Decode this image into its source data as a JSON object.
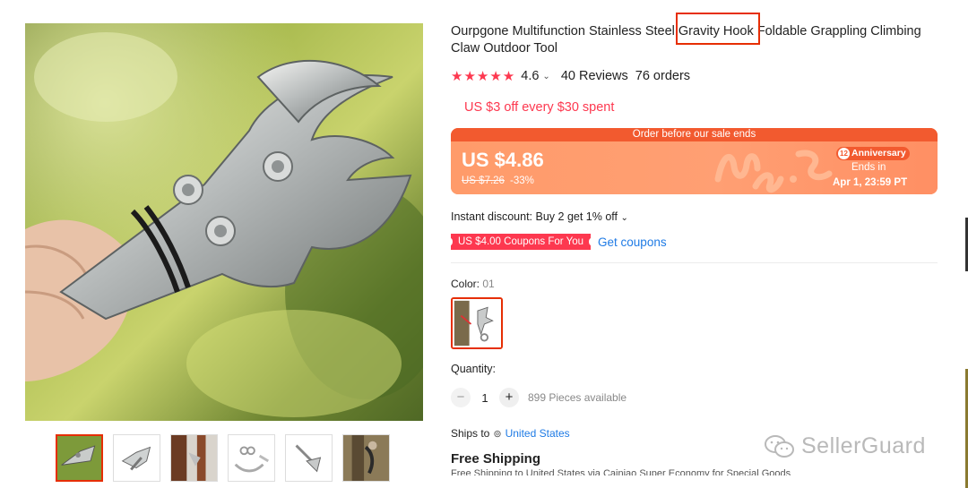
{
  "product": {
    "title": "Ourpgone Multifunction Stainless Steel Gravity Hook Foldable Grappling Climbing Claw Outdoor Tool",
    "highlighted_text": "Gravity Hook",
    "rating": "4.6",
    "stars": 5,
    "reviews": "40 Reviews",
    "orders": "76 orders"
  },
  "promo": {
    "text": "US $3 off every $30 spent"
  },
  "sale": {
    "header": "Order before our sale ends",
    "price": "US $4.86",
    "original_price": "US $7.26",
    "discount": "-33%",
    "badge_number": "12",
    "badge_label": "Anniversary",
    "ends_label": "Ends in",
    "ends_date": "Apr 1, 23:59 PT"
  },
  "discounts": {
    "instant": "Instant discount: Buy 2 get 1% off",
    "coupon_tag": "US $4.00 Coupons For You",
    "get_coupons": "Get coupons"
  },
  "options": {
    "color_label": "Color:",
    "color_value": "01"
  },
  "quantity": {
    "label": "Quantity:",
    "minus": "−",
    "value": "1",
    "plus": "+",
    "available": "899 Pieces available"
  },
  "shipping": {
    "ships_to_label": "Ships to",
    "country": "United States",
    "free_shipping": "Free Shipping",
    "detail": "Free Shipping to United States via Cainiao Super Economy for Special Goods"
  },
  "watermark": {
    "text": "SellerGuard"
  },
  "colors": {
    "accent_red": "#fd384f",
    "highlight_border": "#e62e04",
    "sale_orange": "#ff9a6c",
    "link_blue": "#1f7be5"
  }
}
